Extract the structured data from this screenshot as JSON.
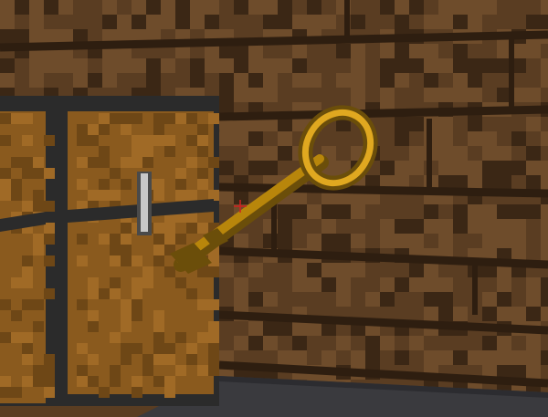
{
  "scene": {
    "palette": {
      "wall_dark": "#3b2715",
      "wall_mid": "#5a3d22",
      "wall_light": "#6e4c2b",
      "wall_seam": "#2e1e10",
      "chest_wood": "#8a5a1e",
      "chest_wood_light": "#a06a26",
      "chest_frame": "#2b2b2b",
      "chest_latch": "#c8c8c8",
      "key_gold": "#b8860b",
      "key_gold_dark": "#6b4e0a",
      "key_gold_light": "#e0a820",
      "floor": "#3a3a3e",
      "crosshair": "#d02020"
    },
    "objects": [
      {
        "name": "wooden-wall",
        "kind": "wall"
      },
      {
        "name": "treasure-chest",
        "kind": "block"
      },
      {
        "name": "golden-key",
        "kind": "item"
      },
      {
        "name": "stone-floor",
        "kind": "floor"
      }
    ]
  },
  "hud": {
    "crosshair_icon": "crosshair-icon"
  }
}
